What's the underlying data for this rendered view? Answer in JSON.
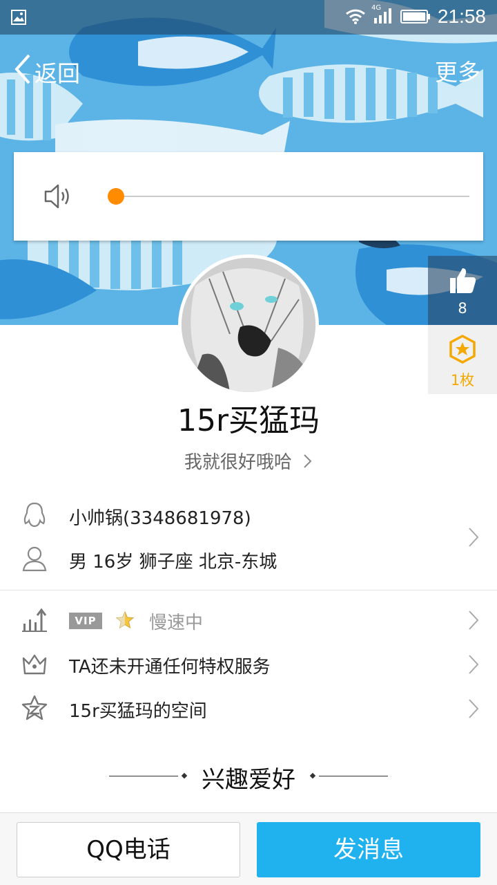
{
  "status_bar": {
    "time": "21:58",
    "network": "4G"
  },
  "nav": {
    "back_label": "返回",
    "more_label": "更多"
  },
  "audio": {
    "progress": 0
  },
  "likes": {
    "count": "8"
  },
  "medals": {
    "count": "1枚"
  },
  "profile": {
    "nickname": "15r买猛玛",
    "signature": "我就很好哦哈"
  },
  "info": {
    "remark_and_qq": "小帅锅(3348681978)",
    "details": "男  16岁  狮子座  北京-东城"
  },
  "vip": {
    "badge": "VIP",
    "status": "慢速中"
  },
  "privilege": {
    "text": "TA还未开通任何特权服务"
  },
  "space": {
    "text": "15r买猛玛的空间"
  },
  "interests": {
    "title": "兴趣爱好"
  },
  "actions": {
    "call_label": "QQ电话",
    "message_label": "发消息"
  },
  "colors": {
    "accent": "#1fb2ef",
    "progress_thumb": "#ff8c00",
    "medal": "#f4a800"
  },
  "icons": [
    "gallery-icon",
    "wifi-icon",
    "signal-icon",
    "battery-icon",
    "back-icon",
    "speaker-icon",
    "thumbs-up-icon",
    "medal-icon",
    "qq-penguin-icon",
    "person-icon",
    "chart-icon",
    "crown-icon",
    "qzone-icon",
    "star-icon",
    "chevron-right-icon"
  ]
}
